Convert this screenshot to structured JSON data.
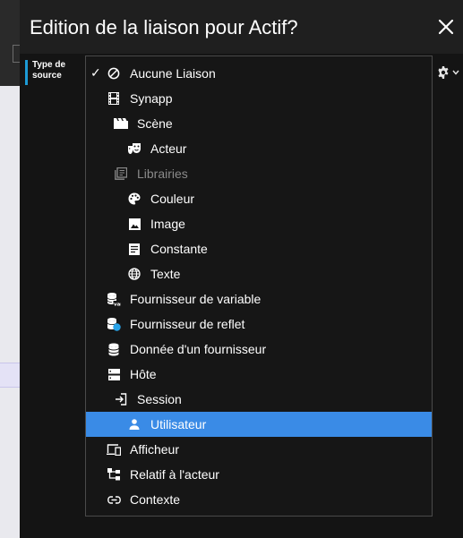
{
  "dialog": {
    "title": "Edition de la liaison pour Actif?",
    "field_label_line1": "Type de",
    "field_label_line2": "source"
  },
  "menu": {
    "items": [
      {
        "label": "Aucune Liaison",
        "icon": "no-link-icon",
        "checked": true
      },
      {
        "label": "Synapp",
        "icon": "film-icon"
      },
      {
        "label": "Scène",
        "icon": "clapperboard-icon"
      },
      {
        "label": "Acteur",
        "icon": "theater-masks-icon"
      },
      {
        "label": "Librairies",
        "icon": "library-icon",
        "disabled": true
      },
      {
        "label": "Couleur",
        "icon": "palette-icon"
      },
      {
        "label": "Image",
        "icon": "image-icon"
      },
      {
        "label": "Constante",
        "icon": "document-lines-icon"
      },
      {
        "label": "Texte",
        "icon": "globe-icon"
      },
      {
        "label": "Fournisseur de variable",
        "icon": "database-var-icon"
      },
      {
        "label": "Fournisseur de reflet",
        "icon": "database-reflect-icon"
      },
      {
        "label": "Donnée d'un fournisseur",
        "icon": "database-icon"
      },
      {
        "label": "Hôte",
        "icon": "server-icon"
      },
      {
        "label": "Session",
        "icon": "login-icon"
      },
      {
        "label": "Utilisateur",
        "icon": "person-icon",
        "selected": true
      },
      {
        "label": "Afficheur",
        "icon": "devices-icon"
      },
      {
        "label": "Relatif à l'acteur",
        "icon": "hierarchy-icon"
      },
      {
        "label": "Contexte",
        "icon": "link-icon"
      }
    ]
  },
  "colors": {
    "accent": "#3a8be6",
    "label_bar": "#1d9bd6",
    "disabled_text": "#8a8a8a",
    "reflect_dot": "#29a3e8"
  }
}
